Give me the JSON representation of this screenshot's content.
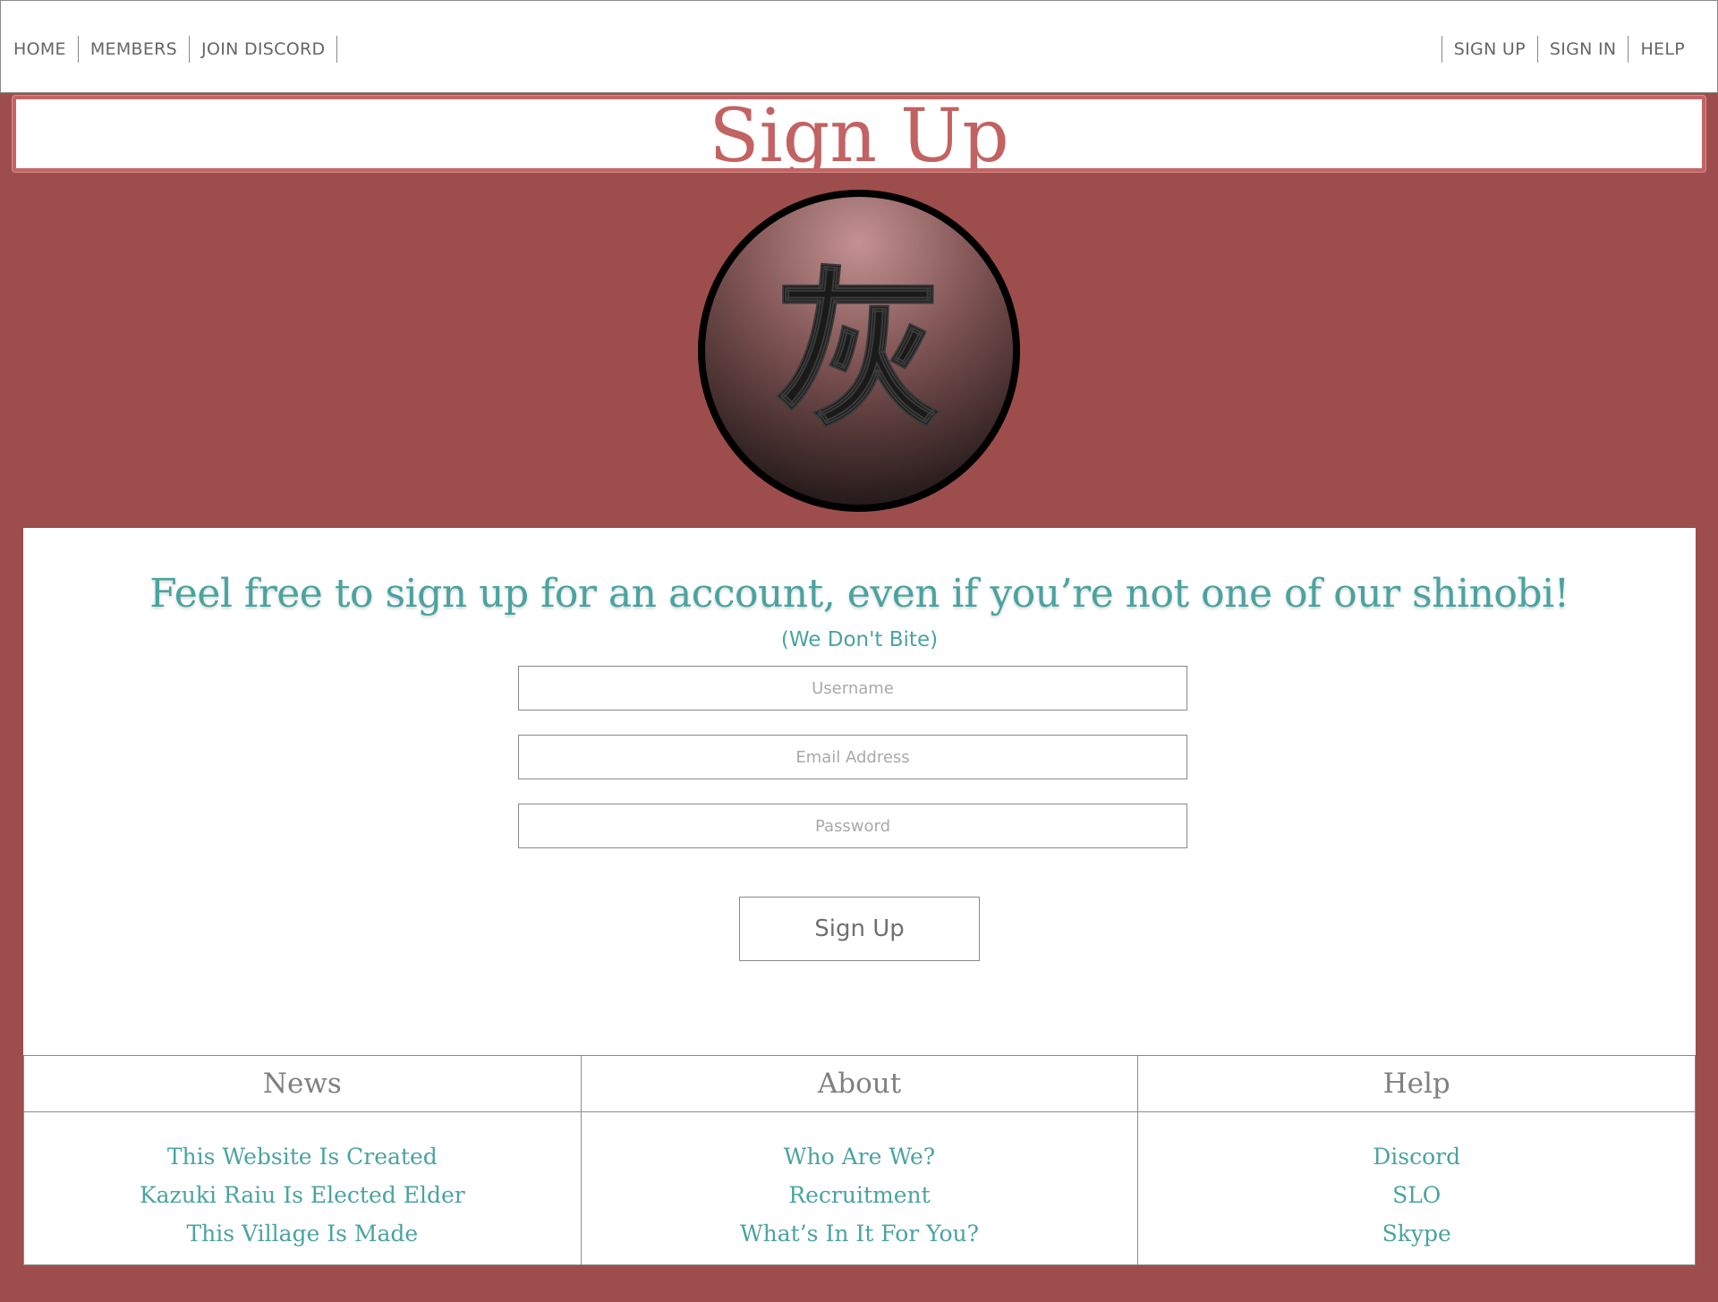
{
  "nav": {
    "left": [
      "HOME",
      "MEMBERS",
      "JOIN DISCORD"
    ],
    "right": [
      "SIGN UP",
      "SIGN IN",
      "HELP"
    ]
  },
  "page_title": "Sign Up",
  "emblem": {
    "glyph": "灰",
    "icon": "village-emblem-icon"
  },
  "form": {
    "headline": "Feel free to sign up for an account, even if you’re not one of our shinobi!",
    "subhead": "(We Don't Bite)",
    "username_placeholder": "Username",
    "email_placeholder": "Email Address",
    "password_placeholder": "Password",
    "submit_label": "Sign Up"
  },
  "footer": {
    "news": {
      "title": "News",
      "items": [
        "This Website Is Created",
        "Kazuki Raiu Is Elected Elder",
        "This Village Is Made"
      ]
    },
    "about": {
      "title": "About",
      "items": [
        "Who Are We?",
        "Recruitment",
        "What’s In It For You?"
      ]
    },
    "help": {
      "title": "Help",
      "items": [
        "Discord",
        "SLO",
        "Skype"
      ]
    }
  },
  "colors": {
    "background": "#9e4d4d",
    "accent_teal": "#4aa3a0",
    "title_red": "#c26262"
  }
}
